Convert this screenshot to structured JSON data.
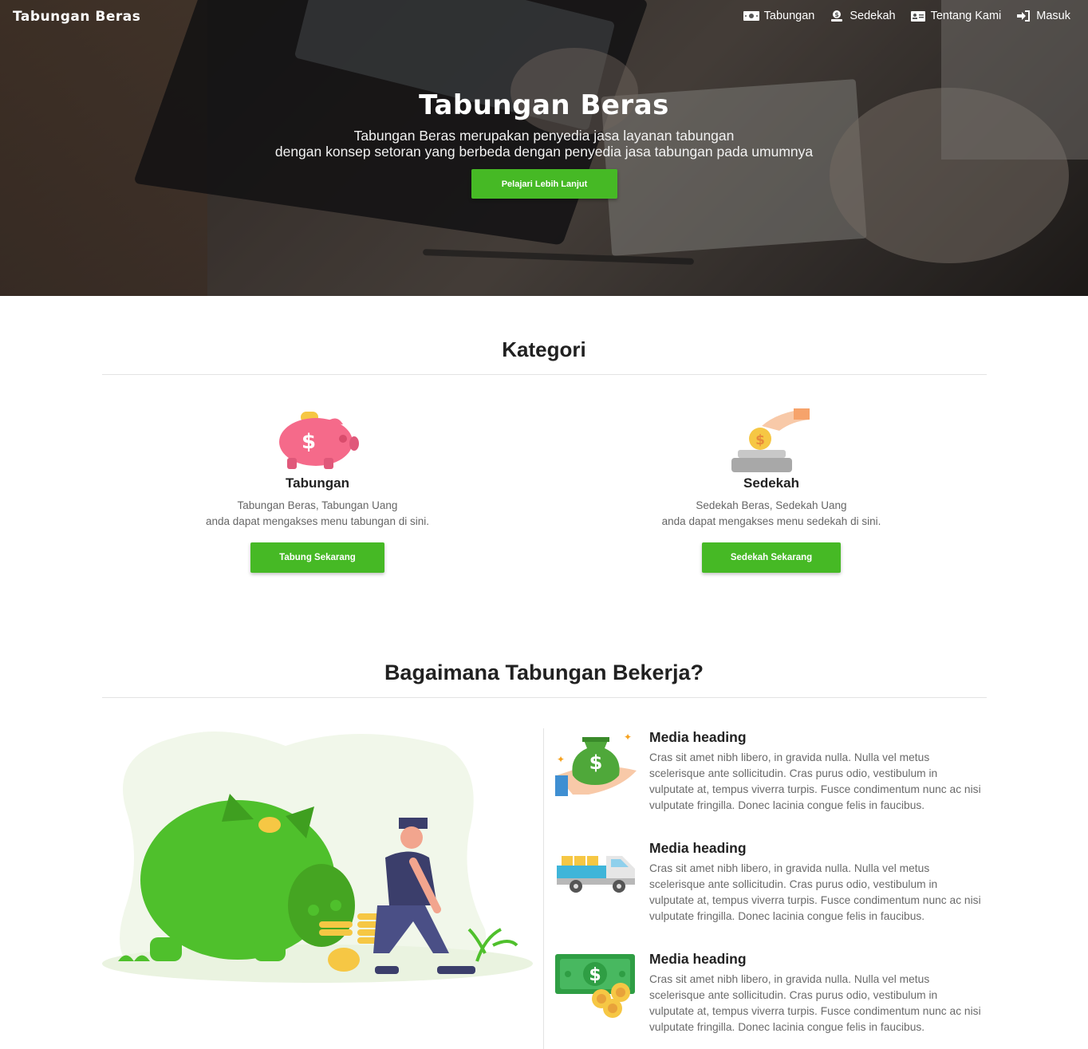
{
  "nav": {
    "brand": "Tabungan Beras",
    "items": [
      {
        "label": "Tabungan",
        "icon": "money-bill-icon"
      },
      {
        "label": "Sedekah",
        "icon": "donate-icon"
      },
      {
        "label": "Tentang Kami",
        "icon": "id-card-icon"
      },
      {
        "label": "Masuk",
        "icon": "sign-in-icon"
      }
    ]
  },
  "hero": {
    "title": "Tabungan Beras",
    "subtitle_line1": "Tabungan Beras merupakan penyedia jasa layanan tabungan",
    "subtitle_line2": "dengan konsep setoran yang berbeda dengan penyedia jasa tabungan pada umumnya",
    "button": "Pelajari Lebih Lanjut"
  },
  "kategori": {
    "title": "Kategori",
    "cards": [
      {
        "name": "Tabungan",
        "desc_line1": "Tabungan Beras, Tabungan Uang",
        "desc_line2": "anda dapat mengakses menu tabungan di sini.",
        "button": "Tabung Sekarang",
        "icon": "piggy-bank-icon"
      },
      {
        "name": "Sedekah",
        "desc_line1": "Sedekah Beras, Sedekah Uang",
        "desc_line2": "anda dapat mengakses menu sedekah di sini.",
        "button": "Sedekah Sekarang",
        "icon": "donation-hand-icon"
      }
    ]
  },
  "how": {
    "title": "Bagaimana Tabungan Bekerja?",
    "illustration": "piggy-bank-person-illustration",
    "media": [
      {
        "heading": "Media heading",
        "text": "Cras sit amet nibh libero, in gravida nulla. Nulla vel metus scelerisque ante sollicitudin. Cras purus odio, vestibulum in vulputate at, tempus viverra turpis. Fusce condimentum nunc ac nisi vulputate fringilla. Donec lacinia congue felis in faucibus.",
        "icon": "money-bag-hand-icon"
      },
      {
        "heading": "Media heading",
        "text": "Cras sit amet nibh libero, in gravida nulla. Nulla vel metus scelerisque ante sollicitudin. Cras purus odio, vestibulum in vulputate at, tempus viverra turpis. Fusce condimentum nunc ac nisi vulputate fringilla. Donec lacinia congue felis in faucibus.",
        "icon": "delivery-truck-icon"
      },
      {
        "heading": "Media heading",
        "text": "Cras sit amet nibh libero, in gravida nulla. Nulla vel metus scelerisque ante sollicitudin. Cras purus odio, vestibulum in vulputate at, tempus viverra turpis. Fusce condimentum nunc ac nisi vulputate fringilla. Donec lacinia congue felis in faucibus.",
        "icon": "cash-coins-icon"
      }
    ]
  },
  "colors": {
    "accent": "#46b925",
    "heading": "#212121",
    "muted": "#6a6a6a"
  }
}
